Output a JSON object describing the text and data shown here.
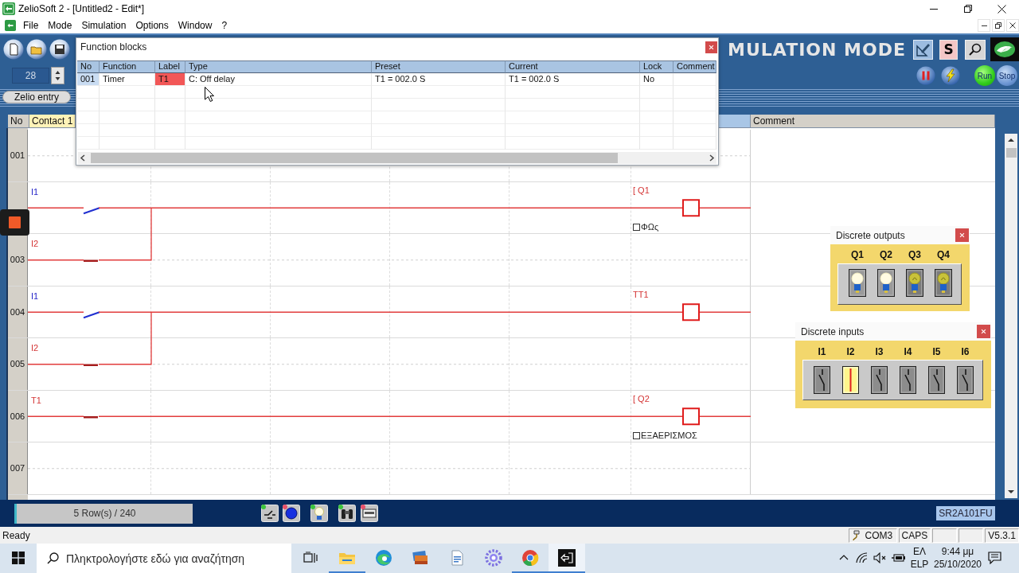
{
  "window": {
    "title": "ZelioSoft 2 - [Untitled2 - Edit*]"
  },
  "menu": [
    {
      "label": "File"
    },
    {
      "label": "Mode"
    },
    {
      "label": "Simulation"
    },
    {
      "label": "Options"
    },
    {
      "label": "Window"
    },
    {
      "label": "?"
    }
  ],
  "toolbar": {
    "banner": "MULATION MODE",
    "s_button": "S",
    "spin_value": "28",
    "run": "Run",
    "stop": "Stop",
    "entry_tab": "Zelio entry"
  },
  "ladder": {
    "columns": [
      {
        "label": "No"
      },
      {
        "label": "Contact 1"
      },
      {
        "label": "Comment"
      }
    ],
    "rows": [
      {
        "number": "001"
      },
      {
        "contact": {
          "label": "I1",
          "on": false
        },
        "coil": {
          "label": "[ Q1",
          "comment": "ΦΩς"
        }
      },
      {
        "number": "003",
        "contact": {
          "label": "I2",
          "on": true
        },
        "parallel": true
      },
      {
        "number": "004",
        "contact": {
          "label": "I1",
          "on": false
        },
        "coil": {
          "label": "TT1"
        }
      },
      {
        "number": "005",
        "contact": {
          "label": "I2",
          "on": true
        },
        "parallel": true
      },
      {
        "number": "006",
        "contact": {
          "label": "T1",
          "on": true
        },
        "coil": {
          "label": "[ Q2",
          "comment": "ΕΞΑΕΡΙΣΜΟΣ"
        }
      },
      {
        "number": "007"
      }
    ]
  },
  "function_blocks": {
    "title": "Function blocks",
    "columns": [
      "No",
      "Function",
      "Label",
      "Type",
      "Preset",
      "Current",
      "Lock",
      "Comment"
    ],
    "rows": [
      {
        "cells": [
          "001",
          "Timer",
          "T1",
          "C: Off delay",
          "T1 = 002.0 S",
          "T1 = 002.0 S",
          "No"
        ],
        "active": true
      }
    ]
  },
  "discrete_outputs": {
    "title": "Discrete outputs",
    "items": [
      {
        "label": "Q1",
        "on": true
      },
      {
        "label": "Q2",
        "on": true
      },
      {
        "label": "Q3",
        "on": false
      },
      {
        "label": "Q4",
        "on": false
      }
    ]
  },
  "discrete_inputs": {
    "title": "Discrete inputs",
    "items": [
      {
        "label": "I1",
        "on": false
      },
      {
        "label": "I2",
        "on": true
      },
      {
        "label": "I3",
        "on": false
      },
      {
        "label": "I4",
        "on": false
      },
      {
        "label": "I5",
        "on": false
      },
      {
        "label": "I6",
        "on": false
      }
    ]
  },
  "status_strip": {
    "rows_info": "5 Row(s) / 240",
    "tools": [
      {
        "color": "#3cc43c"
      },
      {
        "color": "#e8506a"
      },
      {
        "color": "#3cc43c"
      },
      {
        "color": "#3cc43c"
      },
      {
        "color": "#e8506a"
      }
    ],
    "model": "SR2A101FU"
  },
  "status_bar": {
    "message": "Ready",
    "panes": [
      {
        "kind": "port",
        "text": "COM3"
      },
      {
        "kind": "text",
        "text": "CAPS"
      },
      {
        "kind": "empty"
      },
      {
        "kind": "empty"
      },
      {
        "kind": "text",
        "text": "V5.3.1"
      }
    ]
  },
  "taskbar": {
    "search": {
      "placeholder": "Πληκτρολογήστε εδώ για αναζήτηση"
    },
    "apps": [
      {
        "running": true,
        "selected": false
      },
      {
        "running": false,
        "selected": false
      },
      {
        "running": false,
        "selected": false
      },
      {
        "running": false,
        "selected": false
      },
      {
        "running": false,
        "selected": false
      },
      {
        "running": true,
        "selected": false
      },
      {
        "running": true,
        "selected": true
      }
    ],
    "language": {
      "primary": "ΕΛ",
      "secondary": "ELP"
    },
    "clock": {
      "time": "9:44 μμ",
      "date": "25/10/2020"
    }
  }
}
